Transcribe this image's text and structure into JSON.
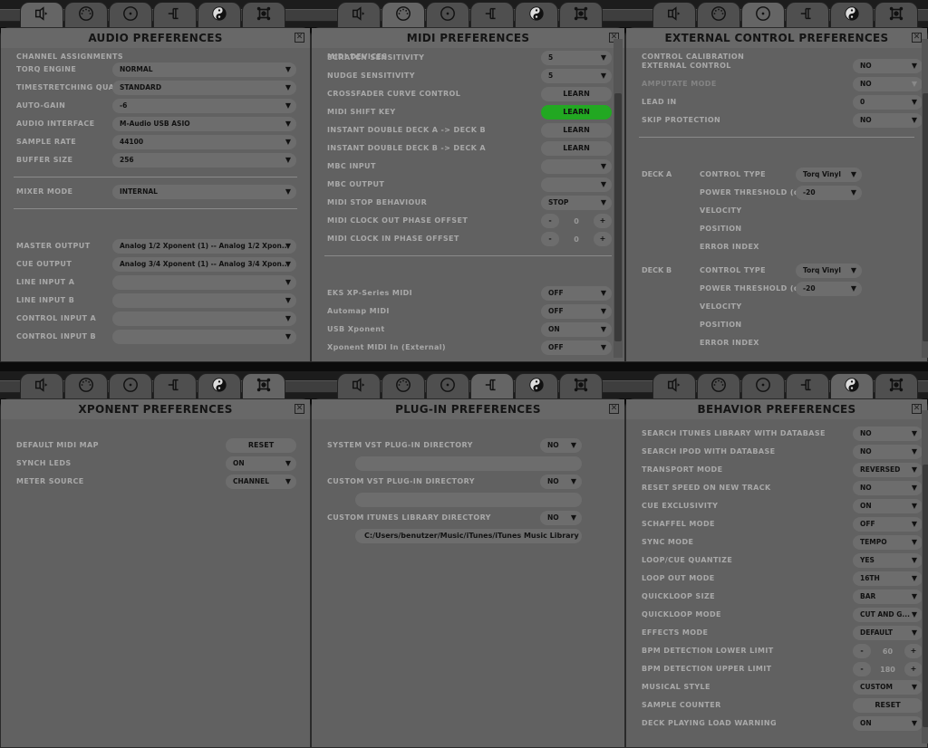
{
  "tabs": [
    {
      "icon": "speaker-icon"
    },
    {
      "icon": "midi-din-icon"
    },
    {
      "icon": "turntable-icon"
    },
    {
      "icon": "plug-icon"
    },
    {
      "icon": "yin-yang-icon"
    },
    {
      "icon": "xponent-icon"
    }
  ],
  "colors": {
    "panel": "#616161",
    "label": "#a9a9a9",
    "control": "#6d6d6d",
    "highlight": "#22a822"
  },
  "panels": [
    {
      "id": "audio",
      "title": "AUDIO PREFERENCES",
      "active_tab": 0,
      "items": [
        {
          "type": "select",
          "label": "TORQ ENGINE",
          "value": "NORMAL"
        },
        {
          "type": "select",
          "label": "TIMESTRETCHING QUALITY",
          "value": "STANDARD"
        },
        {
          "type": "select",
          "label": "AUTO-GAIN",
          "value": "-6"
        },
        {
          "type": "select",
          "label": "AUDIO INTERFACE",
          "value": "M-Audio USB ASIO"
        },
        {
          "type": "select",
          "label": "SAMPLE RATE",
          "value": "44100"
        },
        {
          "type": "select",
          "label": "BUFFER SIZE",
          "value": "256"
        },
        {
          "type": "divider"
        },
        {
          "type": "select",
          "label": "MIXER MODE",
          "value": "INTERNAL"
        },
        {
          "type": "divider"
        },
        {
          "type": "section",
          "label": "CHANNEL ASSIGNMENTS"
        },
        {
          "type": "select",
          "label": "MASTER OUTPUT",
          "value": "Analog 1/2 Xponent (1) -- Analog 1/2 Xpon..."
        },
        {
          "type": "select",
          "label": "CUE OUTPUT",
          "value": "Analog 3/4 Xponent (1) -- Analog 3/4 Xpon..."
        },
        {
          "type": "select",
          "label": "LINE INPUT A",
          "value": ""
        },
        {
          "type": "select",
          "label": "LINE INPUT B",
          "value": ""
        },
        {
          "type": "select",
          "label": "CONTROL INPUT A",
          "value": ""
        },
        {
          "type": "select",
          "label": "CONTROL INPUT B",
          "value": ""
        }
      ]
    },
    {
      "id": "midi",
      "title": "MIDI PREFERENCES",
      "active_tab": 1,
      "items": [
        {
          "type": "select",
          "label": "SCRATCH SENSITIVITY",
          "value": "5"
        },
        {
          "type": "select",
          "label": "NUDGE SENSITIVITY",
          "value": "5"
        },
        {
          "type": "button",
          "label": "CROSSFADER CURVE CONTROL",
          "value": "LEARN"
        },
        {
          "type": "button",
          "label": "MIDI SHIFT KEY",
          "value": "LEARN",
          "highlight": true
        },
        {
          "type": "button",
          "label": "INSTANT DOUBLE DECK A -> DECK B",
          "value": "LEARN"
        },
        {
          "type": "button",
          "label": "INSTANT DOUBLE DECK B -> DECK A",
          "value": "LEARN"
        },
        {
          "type": "select",
          "label": "MBC INPUT",
          "value": ""
        },
        {
          "type": "select",
          "label": "MBC OUTPUT",
          "value": ""
        },
        {
          "type": "select",
          "label": "MIDI STOP BEHAVIOUR",
          "value": "STOP"
        },
        {
          "type": "stepper",
          "label": "MIDI CLOCK OUT PHASE OFFSET",
          "value": "0",
          "minus": "-",
          "plus": "+"
        },
        {
          "type": "stepper",
          "label": "MIDI CLOCK IN PHASE OFFSET",
          "value": "0",
          "minus": "-",
          "plus": "+"
        },
        {
          "type": "divider"
        },
        {
          "type": "section",
          "label": "MIDI DEVICES"
        },
        {
          "type": "select",
          "label": "EKS XP-Series MIDI",
          "value": "OFF"
        },
        {
          "type": "select",
          "label": "Automap MIDI",
          "value": "OFF"
        },
        {
          "type": "select",
          "label": "USB Xponent",
          "value": "ON"
        },
        {
          "type": "select",
          "label": "Xponent MIDI In (External)",
          "value": "OFF"
        }
      ]
    },
    {
      "id": "external",
      "title": "EXTERNAL CONTROL PREFERENCES",
      "active_tab": 2,
      "items": [
        {
          "type": "select",
          "label": "EXTERNAL CONTROL",
          "value": "NO"
        },
        {
          "type": "select",
          "label": "AMPUTATE MODE",
          "value": "NO",
          "disabled": true
        },
        {
          "type": "select",
          "label": "LEAD IN",
          "value": "0"
        },
        {
          "type": "select",
          "label": "SKIP PROTECTION",
          "value": "NO"
        },
        {
          "type": "divider"
        },
        {
          "type": "section",
          "label": "CONTROL CALIBRATION"
        },
        {
          "type": "deck",
          "deck": "DECK A",
          "rows": [
            {
              "label": "CONTROL TYPE",
              "value": "Torq Vinyl"
            },
            {
              "label": "POWER THRESHOLD (dB)",
              "value": "-20"
            },
            {
              "label": "VELOCITY"
            },
            {
              "label": "POSITION"
            },
            {
              "label": "ERROR INDEX"
            }
          ]
        },
        {
          "type": "deck",
          "deck": "DECK B",
          "rows": [
            {
              "label": "CONTROL TYPE",
              "value": "Torq Vinyl"
            },
            {
              "label": "POWER THRESHOLD (dB)",
              "value": "-20"
            },
            {
              "label": "VELOCITY"
            },
            {
              "label": "POSITION"
            },
            {
              "label": "ERROR INDEX"
            }
          ]
        }
      ]
    },
    {
      "id": "xponent",
      "title": "XPONENT PREFERENCES",
      "active_tab": 5,
      "items": [
        {
          "type": "button",
          "label": "DEFAULT MIDI MAP",
          "value": "RESET"
        },
        {
          "type": "select",
          "label": "SYNCH LEDS",
          "value": "ON"
        },
        {
          "type": "select",
          "label": "METER SOURCE",
          "value": "CHANNEL"
        }
      ]
    },
    {
      "id": "plugin",
      "title": "PLUG-IN PREFERENCES",
      "active_tab": 3,
      "items": [
        {
          "type": "select",
          "label": "SYSTEM VST PLUG-IN DIRECTORY",
          "value": "NO"
        },
        {
          "type": "path",
          "value": ""
        },
        {
          "type": "select",
          "label": "CUSTOM VST PLUG-IN DIRECTORY",
          "value": "NO"
        },
        {
          "type": "path",
          "value": ""
        },
        {
          "type": "select",
          "label": "CUSTOM ITUNES LIBRARY DIRECTORY",
          "value": "NO"
        },
        {
          "type": "path",
          "value": "C:/Users/benutzer/Music/iTunes/iTunes Music Library"
        }
      ]
    },
    {
      "id": "behavior",
      "title": "BEHAVIOR PREFERENCES",
      "active_tab": 4,
      "items": [
        {
          "type": "select",
          "label": "SEARCH ITUNES LIBRARY WITH DATABASE",
          "value": "NO"
        },
        {
          "type": "select",
          "label": "SEARCH IPOD WITH DATABASE",
          "value": "NO"
        },
        {
          "type": "select",
          "label": "TRANSPORT MODE",
          "value": "REVERSED"
        },
        {
          "type": "select",
          "label": "RESET SPEED ON NEW TRACK",
          "value": "NO"
        },
        {
          "type": "select",
          "label": "CUE EXCLUSIVITY",
          "value": "ON"
        },
        {
          "type": "select",
          "label": "SCHAFFEL MODE",
          "value": "OFF"
        },
        {
          "type": "select",
          "label": "SYNC MODE",
          "value": "TEMPO"
        },
        {
          "type": "select",
          "label": "LOOP/CUE QUANTIZE",
          "value": "YES"
        },
        {
          "type": "select",
          "label": "LOOP OUT MODE",
          "value": "16TH"
        },
        {
          "type": "select",
          "label": "QUICKLOOP SIZE",
          "value": "BAR"
        },
        {
          "type": "select",
          "label": "QUICKLOOP MODE",
          "value": "CUT AND G..."
        },
        {
          "type": "select",
          "label": "EFFECTS MODE",
          "value": "DEFAULT"
        },
        {
          "type": "stepper",
          "label": "BPM DETECTION LOWER LIMIT",
          "value": "60",
          "minus": "-",
          "plus": "+"
        },
        {
          "type": "stepper",
          "label": "BPM DETECTION UPPER LIMIT",
          "value": "180",
          "minus": "-",
          "plus": "+"
        },
        {
          "type": "select",
          "label": "MUSICAL STYLE",
          "value": "CUSTOM"
        },
        {
          "type": "button",
          "label": "SAMPLE COUNTER",
          "value": "RESET"
        },
        {
          "type": "select",
          "label": "DECK PLAYING LOAD WARNING",
          "value": "ON"
        }
      ]
    }
  ],
  "close_label": "✕",
  "dropdown_arrow": "▼"
}
